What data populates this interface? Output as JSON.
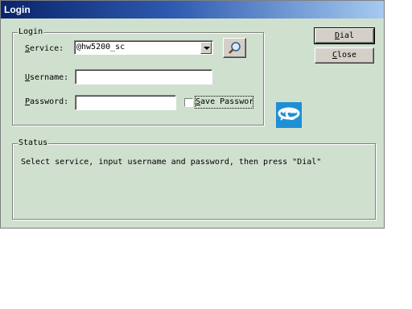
{
  "window": {
    "title": "Login"
  },
  "login_group": {
    "legend": "Login",
    "service": {
      "label_ul": "S",
      "label_rest": "ervice:",
      "value": "@hw5200_sc"
    },
    "username": {
      "label_ul": "U",
      "label_rest": "sername:",
      "value": ""
    },
    "password": {
      "label_ul": "P",
      "label_rest": "assword:",
      "value": ""
    },
    "save_password": {
      "label_ul": "S",
      "label_rest": "ave Passwor",
      "checked": false
    }
  },
  "buttons": {
    "dial": {
      "ul": "D",
      "rest": "ial"
    },
    "close": {
      "ul": "C",
      "rest": "lose"
    }
  },
  "status_group": {
    "legend": "Status",
    "message": "Select service, input username and password, then press \"Dial\""
  },
  "icons": {
    "search": "search-icon",
    "logo": "china-telecom-logo-icon"
  },
  "colors": {
    "window_bg": "#cfe0cf",
    "logo_bg": "#1f8fd6"
  }
}
